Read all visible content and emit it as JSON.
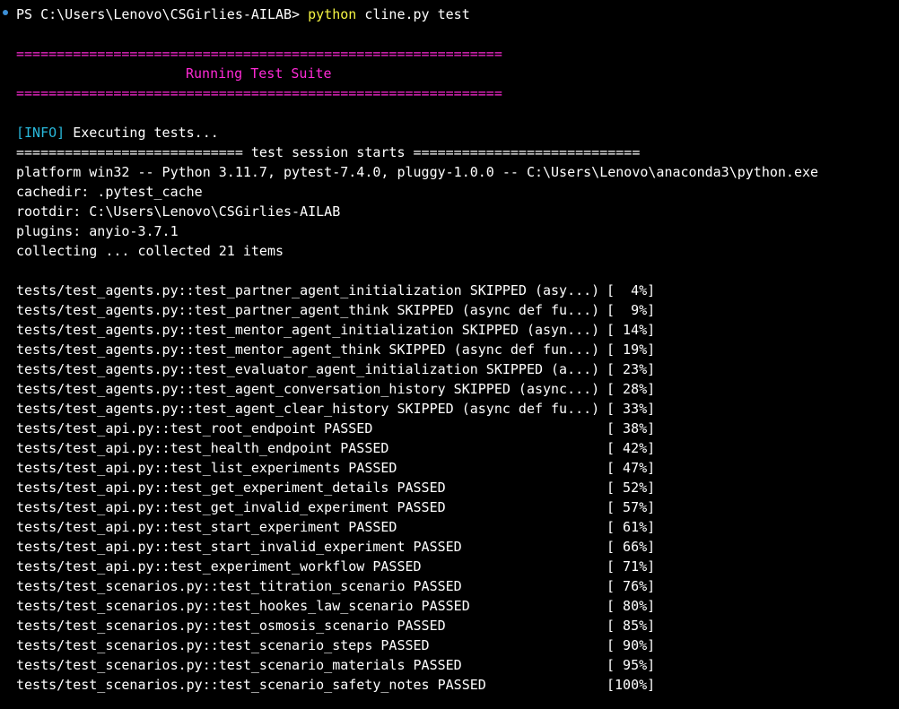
{
  "prompt": {
    "path": "PS C:\\Users\\Lenovo\\CSGirlies-AILAB> ",
    "command": "python",
    "args": " cline.py test"
  },
  "banner": {
    "rule": "============================================================",
    "title": "Running Test Suite"
  },
  "info": {
    "tag": "[INFO]",
    "text": " Executing tests..."
  },
  "session": {
    "header": "============================ test session starts ============================",
    "platform": "platform win32 -- Python 3.11.7, pytest-7.4.0, pluggy-1.0.0 -- C:\\Users\\Lenovo\\anaconda3\\python.exe",
    "cachedir": "cachedir: .pytest_cache",
    "rootdir": "rootdir: C:\\Users\\Lenovo\\CSGirlies-AILAB",
    "plugins": "plugins: anyio-3.7.1",
    "collecting": "collecting ... collected 21 items"
  },
  "results": [
    {
      "test": "tests/test_agents.py::test_partner_agent_initialization SKIPPED (asy...)",
      "pct": "[  4%]"
    },
    {
      "test": "tests/test_agents.py::test_partner_agent_think SKIPPED (async def fu...)",
      "pct": "[  9%]"
    },
    {
      "test": "tests/test_agents.py::test_mentor_agent_initialization SKIPPED (asyn...)",
      "pct": "[ 14%]"
    },
    {
      "test": "tests/test_agents.py::test_mentor_agent_think SKIPPED (async def fun...)",
      "pct": "[ 19%]"
    },
    {
      "test": "tests/test_agents.py::test_evaluator_agent_initialization SKIPPED (a...)",
      "pct": "[ 23%]"
    },
    {
      "test": "tests/test_agents.py::test_agent_conversation_history SKIPPED (async...)",
      "pct": "[ 28%]"
    },
    {
      "test": "tests/test_agents.py::test_agent_clear_history SKIPPED (async def fu...)",
      "pct": "[ 33%]"
    },
    {
      "test": "tests/test_api.py::test_root_endpoint PASSED",
      "pct": "[ 38%]"
    },
    {
      "test": "tests/test_api.py::test_health_endpoint PASSED",
      "pct": "[ 42%]"
    },
    {
      "test": "tests/test_api.py::test_list_experiments PASSED",
      "pct": "[ 47%]"
    },
    {
      "test": "tests/test_api.py::test_get_experiment_details PASSED",
      "pct": "[ 52%]"
    },
    {
      "test": "tests/test_api.py::test_get_invalid_experiment PASSED",
      "pct": "[ 57%]"
    },
    {
      "test": "tests/test_api.py::test_start_experiment PASSED",
      "pct": "[ 61%]"
    },
    {
      "test": "tests/test_api.py::test_start_invalid_experiment PASSED",
      "pct": "[ 66%]"
    },
    {
      "test": "tests/test_api.py::test_experiment_workflow PASSED",
      "pct": "[ 71%]"
    },
    {
      "test": "tests/test_scenarios.py::test_titration_scenario PASSED",
      "pct": "[ 76%]"
    },
    {
      "test": "tests/test_scenarios.py::test_hookes_law_scenario PASSED",
      "pct": "[ 80%]"
    },
    {
      "test": "tests/test_scenarios.py::test_osmosis_scenario PASSED",
      "pct": "[ 85%]"
    },
    {
      "test": "tests/test_scenarios.py::test_scenario_steps PASSED",
      "pct": "[ 90%]"
    },
    {
      "test": "tests/test_scenarios.py::test_scenario_materials PASSED",
      "pct": "[ 95%]"
    },
    {
      "test": "tests/test_scenarios.py::test_scenario_safety_notes PASSED",
      "pct": "[100%]"
    }
  ],
  "colors": {
    "background": "#000000",
    "text": "#ffffff",
    "banner": "#ff2ad6",
    "info": "#29b8db",
    "command": "#f5f543",
    "prompt_dot": "#3c8fd6"
  }
}
